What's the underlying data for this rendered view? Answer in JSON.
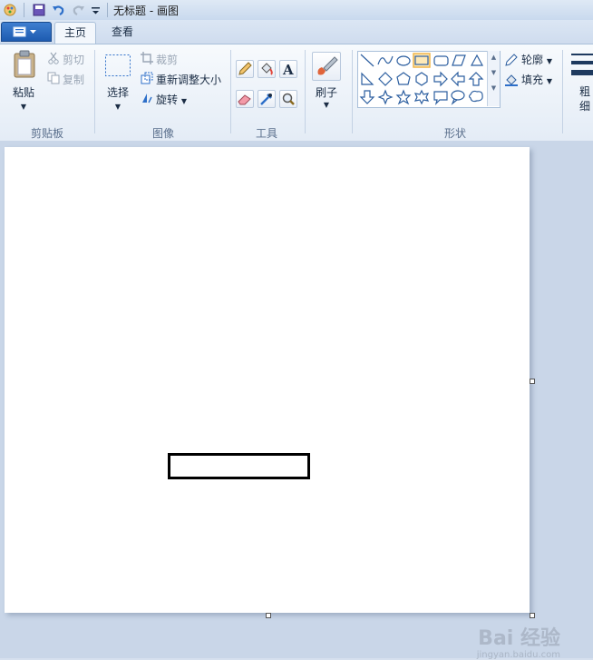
{
  "window": {
    "title": "无标题 - 画图"
  },
  "tabs": [
    {
      "label": "主页",
      "active": true
    },
    {
      "label": "查看",
      "active": false
    }
  ],
  "clipboard": {
    "paste": "粘贴",
    "cut": "剪切",
    "copy": "复制",
    "group": "剪贴板"
  },
  "image": {
    "select": "选择",
    "crop": "裁剪",
    "resize": "重新调整大小",
    "rotate": "旋转",
    "group": "图像"
  },
  "tools": {
    "group": "工具"
  },
  "brushes": {
    "label": "刷子"
  },
  "shapes": {
    "group": "形状",
    "outline": "轮廓",
    "fill": "填充"
  },
  "size": {
    "label_line1": "粗",
    "label_line2": "细"
  },
  "watermark": {
    "main": "Bai 经验",
    "sub": "jingyan.baidu.com"
  },
  "colors": {
    "accent": "#1d5bb0",
    "selected_shape": "#f0b64a"
  }
}
